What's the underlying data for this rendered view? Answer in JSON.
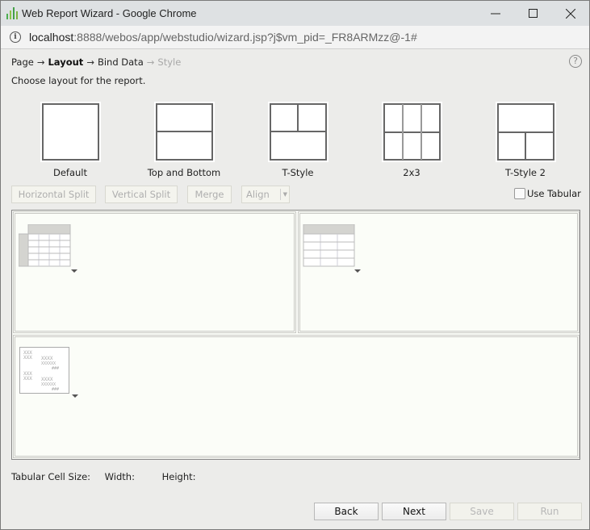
{
  "window": {
    "title": "Web Report Wizard - Google Chrome",
    "url_host": "localhost",
    "url_rest": ":8888/webos/app/webstudio/wizard.jsp?j$vm_pid=_FR8ARMzz@-1#",
    "controls": {
      "minimize": "minimize-icon",
      "maximize": "maximize-icon",
      "close": "close-icon"
    }
  },
  "wizard": {
    "steps": [
      {
        "label": "Page",
        "state": "done"
      },
      {
        "label": "Layout",
        "state": "active"
      },
      {
        "label": "Bind Data",
        "state": "pending"
      },
      {
        "label": "Style",
        "state": "disabled"
      }
    ],
    "arrow": "→",
    "help": "?",
    "instruction": "Choose layout for the report."
  },
  "layouts": [
    {
      "label": "Default",
      "icon": "layout-default-icon"
    },
    {
      "label": "Top and Bottom",
      "icon": "layout-top-bottom-icon"
    },
    {
      "label": "T-Style",
      "icon": "layout-t-style-icon"
    },
    {
      "label": "2x3",
      "icon": "layout-2x3-icon"
    },
    {
      "label": "T-Style 2",
      "icon": "layout-t-style-2-icon"
    }
  ],
  "toolbar": {
    "horizontal_split": "Horizontal Split",
    "vertical_split": "Vertical Split",
    "merge": "Merge",
    "align": "Align",
    "use_tabular": "Use Tabular",
    "use_tabular_checked": false
  },
  "canvas": {
    "cells": [
      {
        "component": "crosstab",
        "icon": "crosstab-icon"
      },
      {
        "component": "table",
        "icon": "table-icon"
      },
      {
        "component": "banded",
        "icon": "banded-report-icon"
      }
    ]
  },
  "cell_size": {
    "label": "Tabular Cell Size:",
    "width_label": "Width:",
    "height_label": "Height:"
  },
  "footer": {
    "back": "Back",
    "next": "Next",
    "save": "Save",
    "run": "Run"
  },
  "colors": {
    "titlebar": "#dee1e3",
    "panel": "#ececea",
    "canvas": "#fbfdf8",
    "disabled_text": "#aeaeae",
    "chrome_icon": "#3cb54a"
  }
}
